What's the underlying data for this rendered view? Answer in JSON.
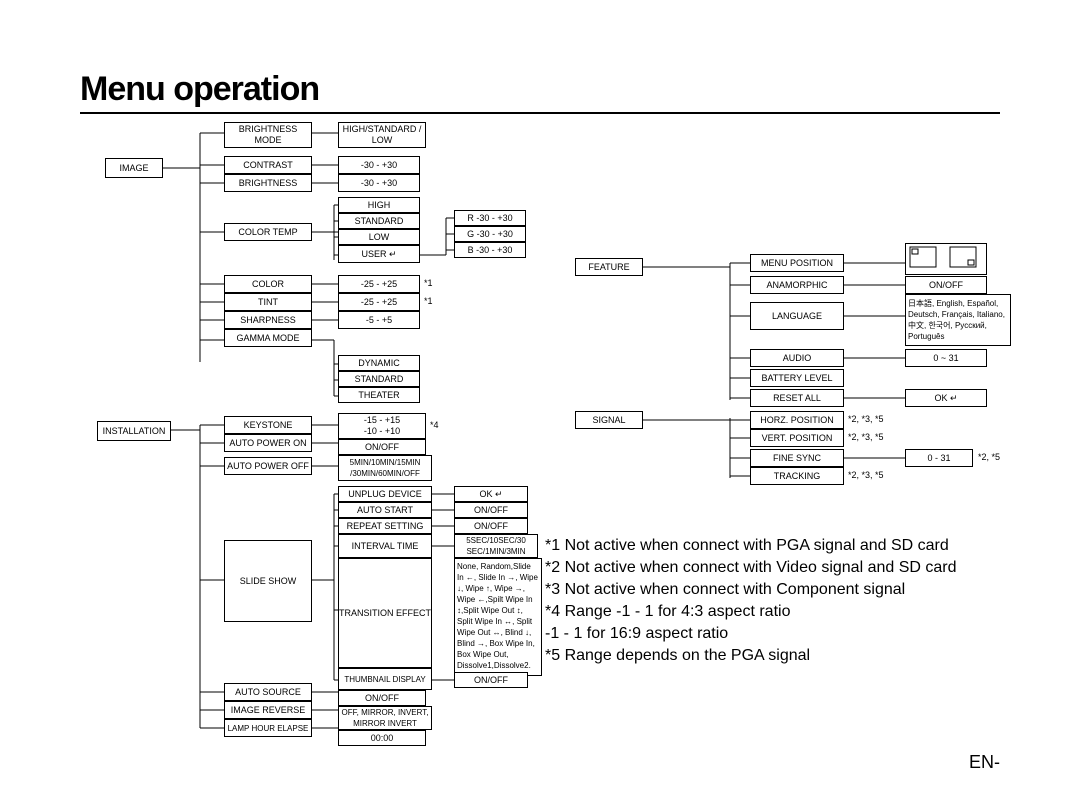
{
  "title": "Menu operation",
  "page_footer": "EN-",
  "col1": {
    "image": "IMAGE",
    "installation": "INSTALLATION"
  },
  "image_items": {
    "brightness_mode": "BRIGHTNESS MODE",
    "contrast": "CONTRAST",
    "brightness": "BRIGHTNESS",
    "color_temp": "COLOR TEMP",
    "color": "COLOR",
    "tint": "TINT",
    "sharpness": "SHARPNESS",
    "gamma_mode": "GAMMA MODE"
  },
  "image_vals": {
    "brightness_mode": "HIGH/STANDARD / LOW",
    "contrast": "-30 - +30",
    "brightness": "-30 - +30",
    "ct_high": "HIGH",
    "ct_standard": "STANDARD",
    "ct_low": "LOW",
    "ct_user": "USER  ↵",
    "rgb_r": "R  -30 - +30",
    "rgb_g": "G  -30 - +30",
    "rgb_b": "B  -30 - +30",
    "color": "-25 - +25",
    "tint": "-25 - +25",
    "sharpness": "-5 - +5",
    "gm_dynamic": "DYNAMIC",
    "gm_standard": "STANDARD",
    "gm_theater": "THEATER"
  },
  "install_items": {
    "keystone": "KEYSTONE",
    "auto_power_on": "AUTO POWER ON",
    "auto_power_off": "AUTO POWER OFF",
    "slide_show": "SLIDE SHOW",
    "auto_source": "AUTO SOURCE",
    "image_reverse": "IMAGE REVERSE",
    "lamp_hour": "LAMP HOUR ELAPSE"
  },
  "install_vals": {
    "keystone": "-15 - +15\n-10 - +10",
    "auto_power_on": "ON/OFF",
    "auto_power_off": "5MIN/10MIN/15MIN /30MIN/60MIN/OFF",
    "slide_unplug": "UNPLUG DEVICE",
    "slide_autostart": "AUTO START",
    "slide_repeat": "REPEAT SETTING",
    "slide_interval": "INTERVAL TIME",
    "slide_transition": "TRANSITION EFFECT",
    "slide_thumb": "THUMBNAIL DISPLAY",
    "unplug_v": "OK  ↵",
    "autostart_v": "ON/OFF",
    "repeat_v": "ON/OFF",
    "interval_v": "5SEC/10SEC/30 SEC/1MIN/3MIN",
    "transition_v": "None, Random,Slide In ←, Slide In →, Wipe ↓, Wipe ↑, Wipe →, Wipe ←,Spilt Wipe In ↕,Split Wipe Out ↕, Split Wipe In ↔, Split Wipe Out ↔, Blind ↓, Blind →, Box Wipe In, Box Wipe Out, Dissolve1,Dissolve2.",
    "thumb_v": "ON/OFF",
    "auto_source": "ON/OFF",
    "image_reverse": "OFF, MIRROR, INVERT, MIRROR INVERT",
    "lamp_hour": "00:00"
  },
  "right_roots": {
    "feature": "FEATURE",
    "signal": "SIGNAL"
  },
  "feature_items": {
    "menu_position": "MENU POSITION",
    "anamorphic": "ANAMORPHIC",
    "language": "LANGUAGE",
    "audio": "AUDIO",
    "battery": "BATTERY LEVEL",
    "reset": "RESET ALL"
  },
  "feature_vals": {
    "anamorphic": "ON/OFF",
    "language": "日本語, English, Español, Deutsch, Français, Italiano, 中文, 한국어, Русский, Português",
    "audio": "0 ~ 31",
    "reset": "OK  ↵"
  },
  "signal_items": {
    "horz": "HORZ. POSITION",
    "vert": "VERT. POSITION",
    "fine": "FINE SYNC",
    "tracking": "TRACKING"
  },
  "signal_vals": {
    "fine": "0 - 31"
  },
  "stars": {
    "s1": "*1",
    "s4": "*4",
    "s235": "*2, *3, *5",
    "s25": "*2, *5"
  },
  "notes": {
    "l1": "*1 Not active when connect with PGA signal and SD card",
    "l2": "*2 Not active when connect with Video signal and SD card",
    "l3": "*3 Not active when connect with Component signal",
    "l4": "*4 Range       -1 - 1 for 4:3 aspect ratio",
    "l5": "                    -1 - 1 for 16:9 aspect ratio",
    "l6": "*5 Range depends on the PGA signal"
  }
}
